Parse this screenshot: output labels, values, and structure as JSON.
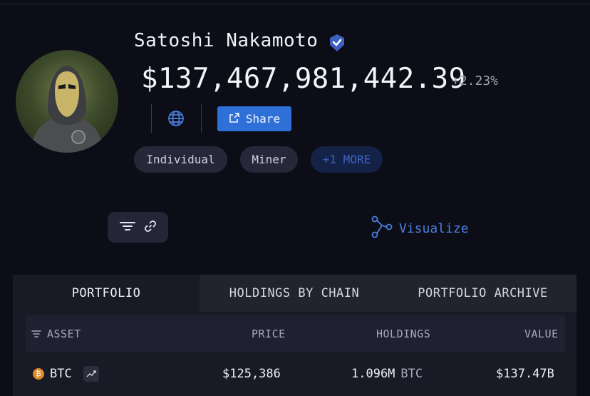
{
  "profile": {
    "name": "Satoshi Nakamoto",
    "net_worth": "$137,467,981,442.39",
    "change": "+2.23%",
    "share_label": "Share",
    "tags": [
      "Individual",
      "Miner",
      "+1 MORE"
    ],
    "visualize_label": "Visualize"
  },
  "tabs": [
    "PORTFOLIO",
    "HOLDINGS BY CHAIN",
    "PORTFOLIO ARCHIVE"
  ],
  "table": {
    "headers": {
      "asset": "ASSET",
      "price": "PRICE",
      "holdings": "HOLDINGS",
      "value": "VALUE"
    },
    "rows": [
      {
        "asset": "BTC",
        "price": "$125,386",
        "holdings": "1.096M",
        "unit": "BTC",
        "value": "$137.47B"
      }
    ]
  },
  "colors": {
    "accent": "#2f6fd8",
    "link": "#4b7fe0",
    "bitcoin": "#e08b2a"
  },
  "icons": [
    "verified-badge-icon",
    "globe-icon",
    "external-link-icon",
    "filter-icon",
    "link-icon",
    "graph-icon",
    "sort-icon",
    "bitcoin-icon",
    "trend-icon"
  ]
}
